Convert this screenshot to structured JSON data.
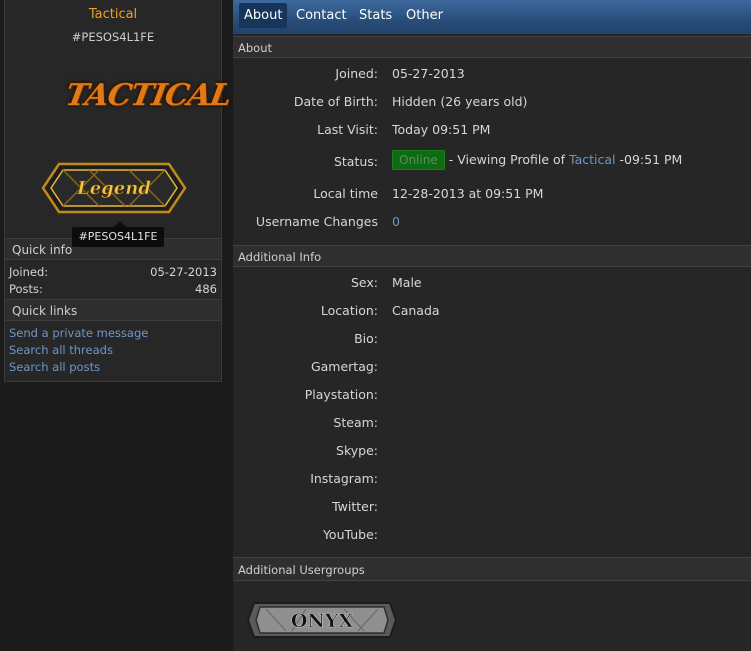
{
  "sidebar": {
    "username": "Tactical",
    "user_id": "#PESOS4L1FE",
    "logo_text": "TACTICAL",
    "badge_text": "Legend",
    "tooltip": "#PESOS4L1FE",
    "quick_info": {
      "title": "Quick info",
      "rows": [
        {
          "label": "Joined:",
          "value": "05-27-2013"
        },
        {
          "label": "Posts:",
          "value": "486"
        }
      ]
    },
    "quick_links": {
      "title": "Quick links",
      "items": [
        "Send a private message",
        "Search all threads",
        "Search all posts"
      ]
    }
  },
  "tabs": [
    {
      "label": "About",
      "active": true
    },
    {
      "label": "Contact",
      "active": false
    },
    {
      "label": "Stats",
      "active": false
    },
    {
      "label": "Other",
      "active": false
    }
  ],
  "about": {
    "title": "About",
    "joined": {
      "label": "Joined:",
      "value": "05-27-2013"
    },
    "dob": {
      "label": "Date of Birth:",
      "value": "Hidden (26 years old)"
    },
    "last_visit": {
      "label": "Last Visit:",
      "value": "Today 09:51 PM"
    },
    "status": {
      "label": "Status:",
      "badge": "Online",
      "prefix": "- Viewing Profile of",
      "link": "Tactical",
      "suffix": "-09:51 PM"
    },
    "local_time": {
      "label": "Local time",
      "value": "12-28-2013 at 09:51 PM"
    },
    "username_changes": {
      "label": "Username Changes",
      "value": "0"
    }
  },
  "additional_info": {
    "title": "Additional Info",
    "rows": [
      {
        "label": "Sex:",
        "value": "Male"
      },
      {
        "label": "Location:",
        "value": "Canada"
      },
      {
        "label": "Bio:",
        "value": ""
      },
      {
        "label": "Gamertag:",
        "value": ""
      },
      {
        "label": "Playstation:",
        "value": ""
      },
      {
        "label": "Steam:",
        "value": ""
      },
      {
        "label": "Skype:",
        "value": ""
      },
      {
        "label": "Instagram:",
        "value": ""
      },
      {
        "label": "Twitter:",
        "value": ""
      },
      {
        "label": "YouTube:",
        "value": ""
      }
    ]
  },
  "usergroups": {
    "title": "Additional Usergroups",
    "badge_text": "ONYX"
  },
  "colors": {
    "accent": "#f0a020",
    "link": "#6f96c8",
    "tab_bar": "#2a5182",
    "online": "#0e6b13"
  }
}
